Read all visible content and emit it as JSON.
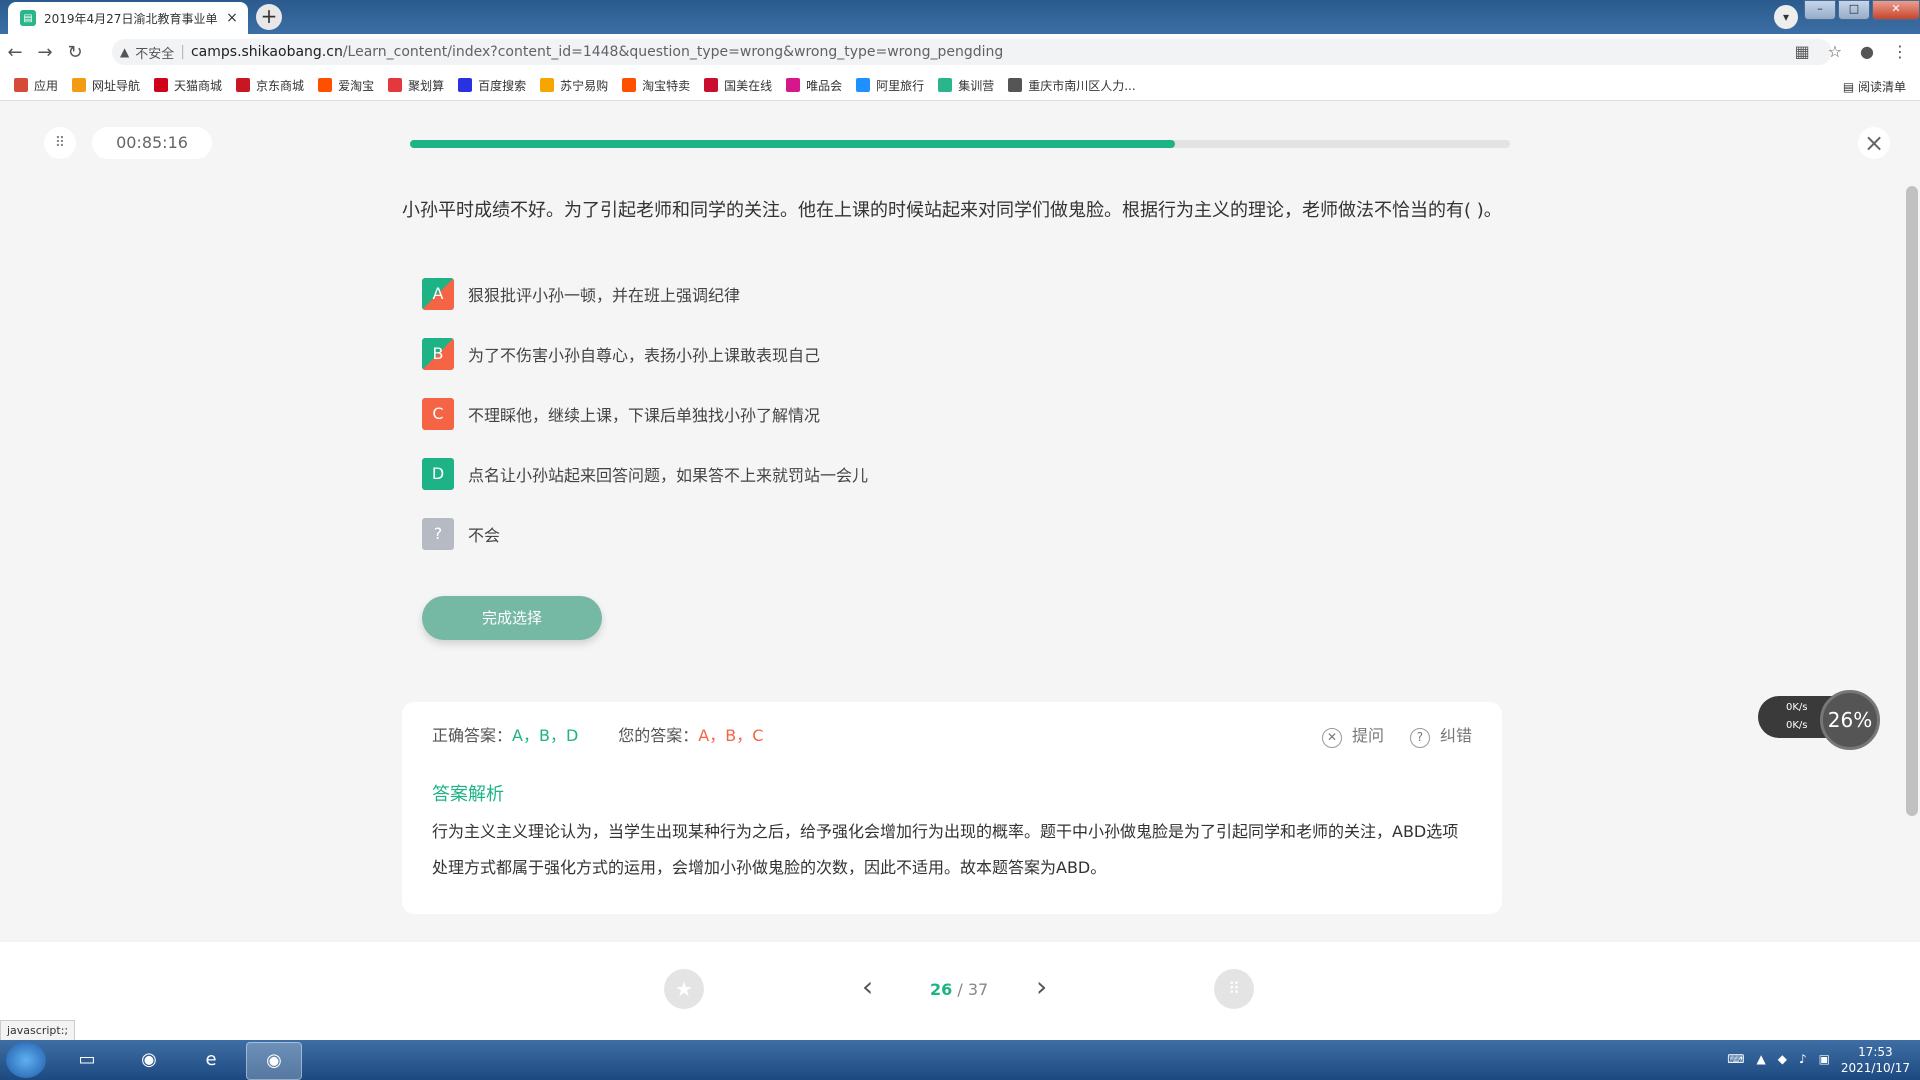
{
  "browser": {
    "tab_title": "2019年4月27日渝北教育事业单",
    "tab_close": "×",
    "new_tab": "+",
    "security_label": "不安全",
    "url_host": "camps.shikaobang.cn",
    "url_rest": "/Learn_content/index?content_id=1448&question_type=wrong&wrong_type=wrong_pengding"
  },
  "bookmarks": [
    {
      "label": "应用",
      "color": "#d64a3a"
    },
    {
      "label": "网址导航",
      "color": "#f39c12"
    },
    {
      "label": "天猫商城",
      "color": "#d0021b"
    },
    {
      "label": "京东商城",
      "color": "#c81623"
    },
    {
      "label": "爱淘宝",
      "color": "#ff5000"
    },
    {
      "label": "聚划算",
      "color": "#e4393c"
    },
    {
      "label": "百度搜索",
      "color": "#2932e1"
    },
    {
      "label": "苏宁易购",
      "color": "#f7a600"
    },
    {
      "label": "淘宝特卖",
      "color": "#ff5000"
    },
    {
      "label": "国美在线",
      "color": "#c8102e"
    },
    {
      "label": "唯品会",
      "color": "#d6168b"
    },
    {
      "label": "阿里旅行",
      "color": "#1e90ff"
    },
    {
      "label": "集训营",
      "color": "#2ab58a"
    },
    {
      "label": "重庆市南川区人力...",
      "color": "#555555"
    }
  ],
  "reading_list": "阅读清单",
  "quiz": {
    "timer": "00:85:16",
    "progress_fraction": 0.695,
    "question": "小孙平时成绩不好。为了引起老师和同学的关注。他在上课的时候站起来对同学们做鬼脸。根据行为主义的理论，老师做法不恰当的有( )。",
    "options": [
      {
        "key": "A",
        "text": "狠狠批评小孙一顿，并在班上强调纪律",
        "state": "wrong"
      },
      {
        "key": "B",
        "text": "为了不伤害小孙自尊心，表扬小孙上课敢表现自己",
        "state": "wrong"
      },
      {
        "key": "C",
        "text": "不理睬他，继续上课，下课后单独找小孙了解情况",
        "state": "red"
      },
      {
        "key": "D",
        "text": "点名让小孙站起来回答问题，如果答不上来就罚站一会儿",
        "state": "green"
      },
      {
        "key": "?",
        "text": "不会",
        "state": "grey"
      }
    ],
    "submit_label": "完成选择",
    "correct_label": "正确答案：",
    "correct_value": "A，B，D",
    "your_label": "您的答案：",
    "your_value": "A，B，C",
    "ask_label": "提问",
    "report_label": "纠错",
    "analysis_title": "答案解析",
    "analysis_text": "行为主义主义理论认为，当学生出现某种行为之后，给予强化会增加行为出现的概率。题干中小孙做鬼脸是为了引起同学和老师的关注，ABD选项处理方式都属于强化方式的运用，会增加小孙做鬼脸的次数，因此不适用。故本题答案为ABD。",
    "page_current": "26",
    "page_total": "/ 37"
  },
  "speed_widget": {
    "up": "0K/s",
    "down": "0K/s",
    "percent": "26%"
  },
  "status_link": "javascript:;",
  "taskbar": {
    "time": "17:53",
    "date": "2021/10/17"
  }
}
